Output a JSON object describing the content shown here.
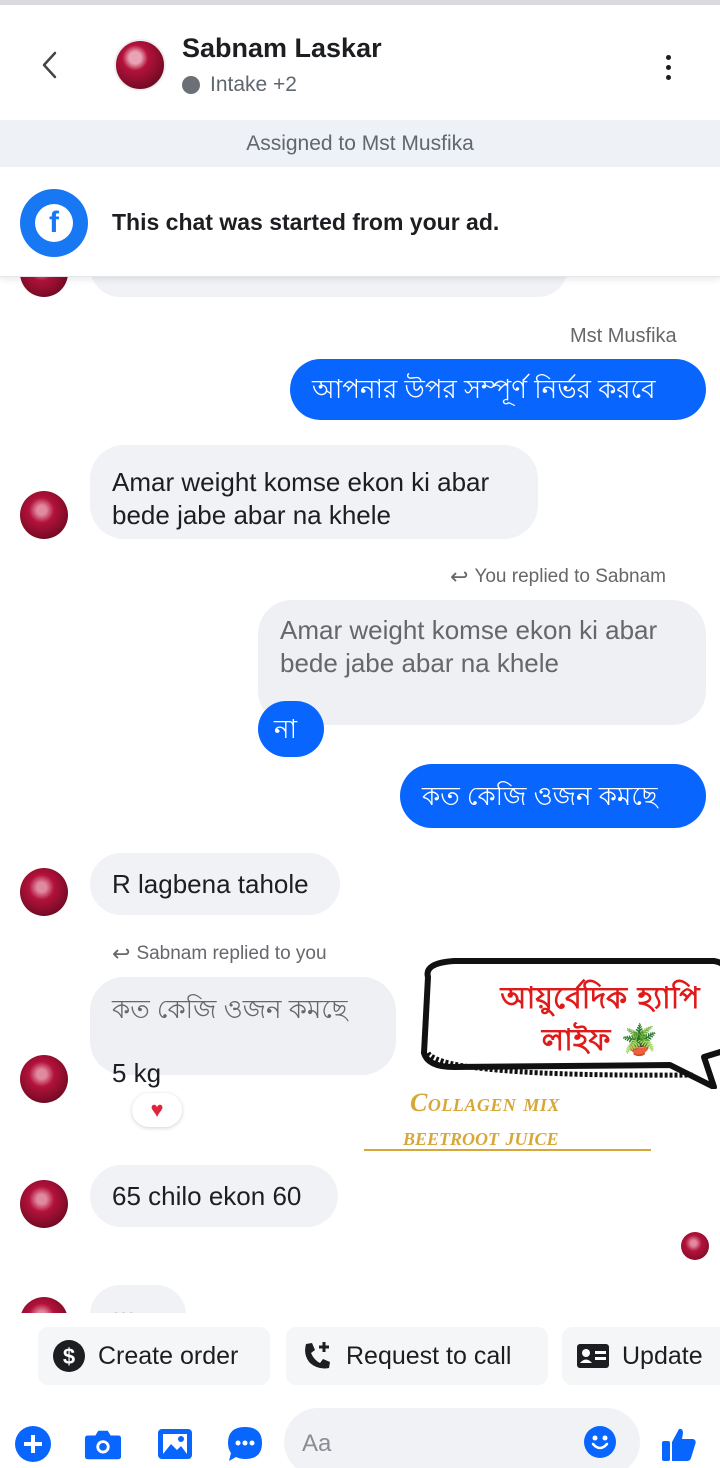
{
  "header": {
    "name": "Sabnam Laskar",
    "status": "Intake +2",
    "assigned": "Assigned to Mst Musfika",
    "ad_notice": "This chat was started from your ad."
  },
  "messages": {
    "sender_label": "Mst Musfika",
    "out1": "আপনার উপর সম্পূর্ণ নির্ভর করবে",
    "in1": [
      "Amar weight komse ekon ki abar",
      "bede jabe abar na khele"
    ],
    "replied_label_you": "You replied to Sabnam",
    "quoted_text": [
      "Amar weight komse ekon ki abar",
      "bede jabe abar na khele"
    ],
    "out_reply": "না",
    "out2": "কত কেজি ওজন কমছে",
    "in2": "R lagbena tahole",
    "replied_label_her": "Sabnam replied to you",
    "quoted_her": "কত কেজি ওজন কমছে",
    "in3": "5 kg",
    "reaction": "♥",
    "in4": "65 chilo ekon 60",
    "typing": "•••"
  },
  "overlay": {
    "callout_line1": "আয়ুর্বেদিক হ্যাপি",
    "callout_line2": "লাইফ 🪴",
    "gold_line1": "Collagen mix",
    "gold_line2": "beetroot juice"
  },
  "actions": {
    "create_order": "Create order",
    "request_call": "Request to call",
    "update": "Update"
  },
  "composer": {
    "placeholder": "Aa"
  }
}
